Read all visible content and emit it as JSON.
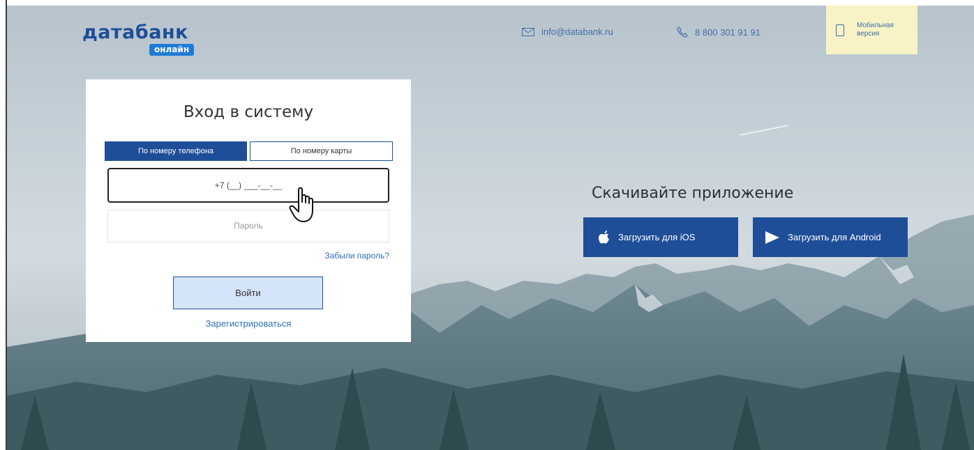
{
  "header": {
    "logo_main": "датабанк",
    "logo_sub": "онлайн",
    "email": "info@databank.ru",
    "phone": "8 800 301 91 91",
    "mobile_line1": "Мобильная",
    "mobile_line2": "версия"
  },
  "login": {
    "title": "Вход в систему",
    "tabs": [
      {
        "label": "По номеру телефона",
        "active": true
      },
      {
        "label": "По номеру карты",
        "active": false
      }
    ],
    "phone_mask": "+7 (__) ___-__-__",
    "password_placeholder": "Пароль",
    "forgot_link": "Забыли пароль?",
    "submit_label": "Войти",
    "register_link": "Зарегистрироваться"
  },
  "download": {
    "title": "Скачивайте приложение",
    "ios_label": "Загрузить для iOS",
    "android_label": "Загрузить для Android"
  },
  "icons": {
    "mail": "mail-icon",
    "phone": "phone-icon",
    "mobile": "mobile-phone-icon",
    "apple": "apple-icon",
    "android": "play-store-icon",
    "cursor": "hand-cursor-icon"
  },
  "colors": {
    "brand": "#1f4e98",
    "logo_badge": "#1f7ad8",
    "link": "#2f6fb8",
    "mobile_box": "#f7f3c6",
    "login_button": "#d4e4f9"
  }
}
